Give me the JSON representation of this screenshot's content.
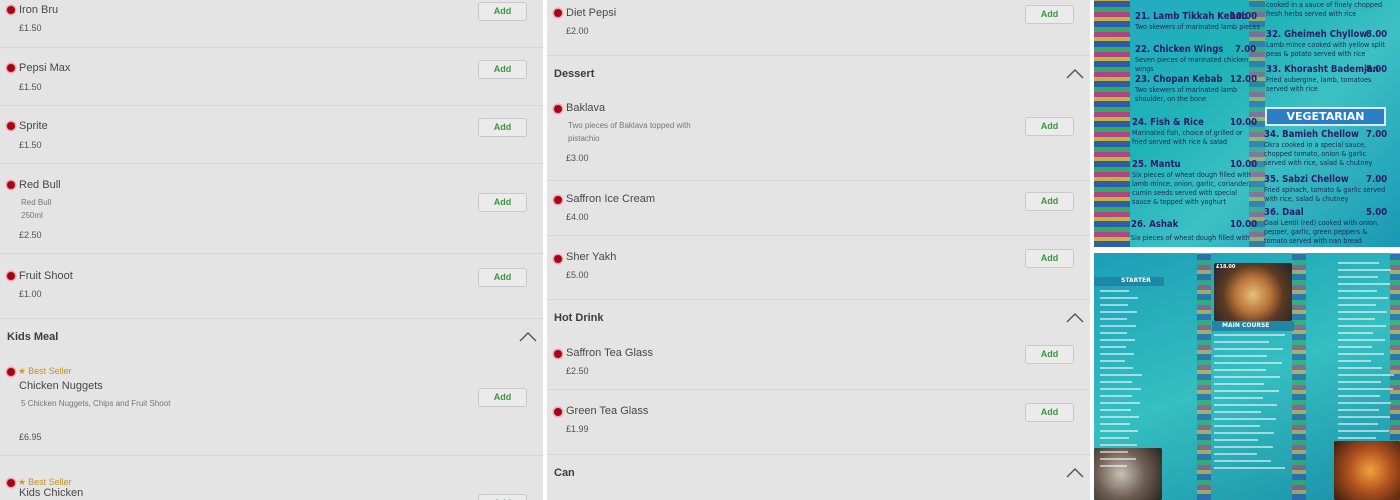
{
  "columns": [
    {
      "items": [
        {
          "name": "Iron Bru",
          "price": "£1.50"
        },
        {
          "name": "Pepsi Max",
          "price": "£1.50"
        },
        {
          "name": "Sprite",
          "price": "£1.50"
        },
        {
          "name": "Red Bull",
          "desc": "Red Bull\n250ml",
          "price": "£2.50"
        },
        {
          "name": "Fruit Shoot",
          "price": "£1.00"
        }
      ],
      "section": {
        "title": "Kids Meal"
      },
      "section_items": [
        {
          "badge": "Best Seller",
          "name": "Chicken Nuggets",
          "desc": "5 Chicken Nuggets, Chips and Fruit Shoot",
          "price": "£6.95"
        },
        {
          "badge": "Best Seller",
          "name": "Kids Chicken"
        }
      ]
    },
    {
      "items": [
        {
          "name": "Diet Pepsi",
          "price": "£2.00"
        }
      ],
      "sections": [
        {
          "title": "Dessert",
          "items": [
            {
              "name": "Baklava",
              "desc": "Two pieces of Baklava topped with pistachio",
              "price": "£3.00"
            },
            {
              "name": "Saffron Ice Cream",
              "price": "£4.00"
            },
            {
              "name": "Sher Yakh",
              "price": "£5.00"
            }
          ]
        },
        {
          "title": "Hot Drink",
          "items": [
            {
              "name": "Saffron Tea Glass",
              "price": "£2.50"
            },
            {
              "name": "Green Tea Glass",
              "price": "£1.99"
            }
          ]
        },
        {
          "title": "Can",
          "items": []
        }
      ]
    }
  ],
  "add_label": "Add",
  "menu_photo_1": {
    "entries": [
      {
        "title": "21. Lamb Tikkah Kebab",
        "price": "10.00",
        "desc": "Two skewers of marinated lamb pieces"
      },
      {
        "title": "22. Chicken Wings",
        "price": "7.00",
        "desc": "Seven pieces of marinated chicken wings"
      },
      {
        "title": "23. Chopan Kebab",
        "price": "12.00",
        "desc": "Two skewers of marinated lamb shoulder, on the bone"
      },
      {
        "title": "24. Fish & Rice",
        "price": "10.00",
        "desc": "Marinated fish, choice of grilled or fried served with rice & salad"
      },
      {
        "title": "25. Mantu",
        "price": "10.00",
        "desc": "Six pieces of wheat dough filled with lamb mince, onion, garlic, coriander, cumin seeds served with special sauce & topped with yoghurt"
      },
      {
        "title": "26. Ashak",
        "price": "10.00",
        "desc": "Six pieces of wheat dough filled with"
      },
      {
        "title": "32. Gheimeh Chyllow",
        "price": "8.00",
        "desc": "Lamb mince cooked with yellow split peas & potato served with rice"
      },
      {
        "title": "33. Khorasht Bademjan",
        "price": "8.00",
        "desc": "Fried aubergine, lamb, tomatoes served with rice"
      },
      {
        "title": "34. Bamieh Chellow",
        "price": "7.00",
        "desc": "Okra cooked in a special sauce, chopped tomato, onion & garlic served with rice, salad & chutney"
      },
      {
        "title": "35. Sabzi Chellow",
        "price": "7.00",
        "desc": "Fried spinach, tomato & garlic served with rice, salad & chutney"
      },
      {
        "title": "36. Daal",
        "price": "5.00",
        "desc": "Daal Lentil (red) cooked with onion, pepper, garlic, green peppers & tomato served with nan bread"
      }
    ],
    "top_right_desc": "cooked in a sauce of finely chopped fresh herbs served with rice",
    "banner": "VEGETARIAN"
  },
  "menu_photo_2": {
    "labels": {
      "starter": "STARTER",
      "main_course": "MAIN COURSE",
      "price_tag": "£18.00"
    }
  },
  "colors": {
    "accent_green": "#3f9b3f",
    "dot_red": "#b0001a",
    "badge_gold": "#c9972c",
    "menu_teal": "#25a9c2",
    "banner_blue": "#2a7fc4"
  }
}
